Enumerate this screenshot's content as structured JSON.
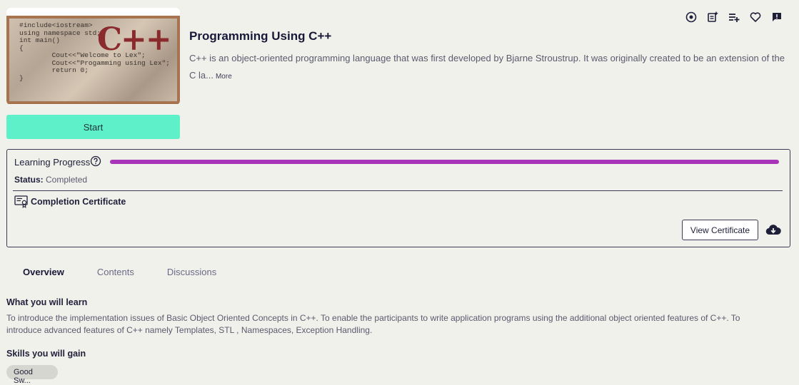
{
  "course": {
    "thumbnail_code": "#include<iostream>\nusing namespace std;\nint main()\n{\n        Cout<<\"Welcome to Lex\";\n        Cout<<\"Progamming using Lex\";\n        return 0;\n}",
    "thumbnail_logo": "C++",
    "title": "Programming Using C++",
    "description": "C++ is an object-oriented programming language that was first developed by Bjarne Stroustrup. It was originally created to be an extension of the C la...",
    "more_label": "More",
    "start_label": "Start"
  },
  "top_icons": [
    "target-icon",
    "add-note-icon",
    "add-to-playlist-icon",
    "heart-icon",
    "feedback-icon"
  ],
  "progress": {
    "label": "Learning Progress",
    "value": 100,
    "bar_color": "#a834b8",
    "status_label": "Status:",
    "status_value": "Completed",
    "certificate_label": "Completion Certificate",
    "view_certificate_label": "View Certificate"
  },
  "tabs": [
    {
      "label": "Overview",
      "active": true
    },
    {
      "label": "Contents",
      "active": false
    },
    {
      "label": "Discussions",
      "active": false
    }
  ],
  "overview": {
    "learn_heading": "What you will learn",
    "learn_text": "To introduce the implementation issues of Basic Object Oriented Concepts in C++. To enable the participants to write application programs using the additional object oriented features of C++. To introduce advanced features of C++ namely Templates, STL , Namespaces, Exception Handling.",
    "skills_heading": "Skills you will gain",
    "skills": [
      "Good Sw..."
    ]
  },
  "colors": {
    "accent_start": "#5ef0c8",
    "progress": "#a834b8",
    "background": "#f1f1ec"
  }
}
